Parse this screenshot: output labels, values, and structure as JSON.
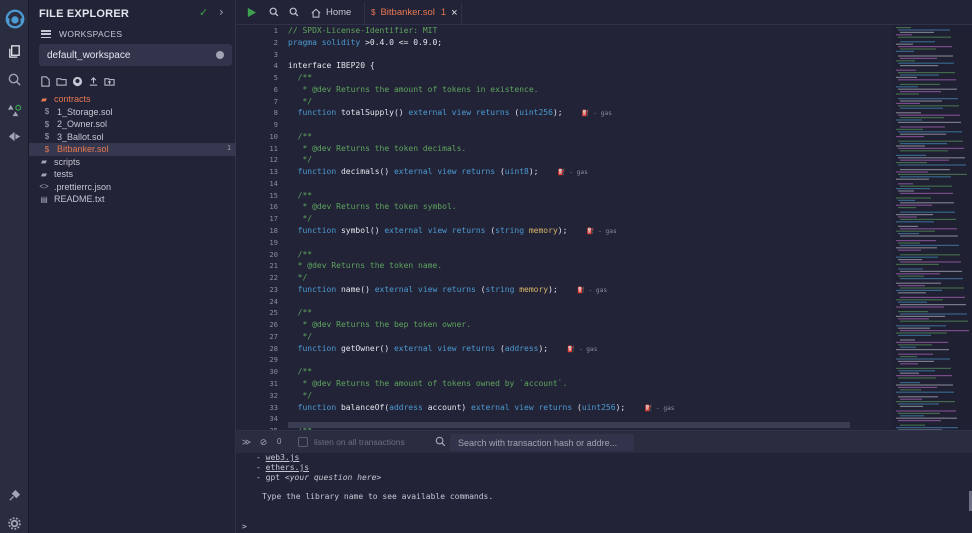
{
  "explorer": {
    "title": "FILE EXPLORER",
    "workspaces_label": "WORKSPACES",
    "workspace_selected": "default_workspace",
    "tree": [
      {
        "label": "contracts",
        "type": "folder",
        "level": 0,
        "state": "open"
      },
      {
        "label": "1_Storage.sol",
        "type": "sol",
        "level": 1,
        "state": ""
      },
      {
        "label": "2_Owner.sol",
        "type": "sol",
        "level": 1,
        "state": ""
      },
      {
        "label": "3_Ballot.sol",
        "type": "sol",
        "level": 1,
        "state": ""
      },
      {
        "label": "Bitbanker.sol",
        "type": "sol",
        "level": 1,
        "state": "selected"
      },
      {
        "label": "scripts",
        "type": "folder",
        "level": 0,
        "state": ""
      },
      {
        "label": "tests",
        "type": "folder",
        "level": 0,
        "state": ""
      },
      {
        "label": ".prettierrc.json",
        "type": "json",
        "level": 0,
        "state": ""
      },
      {
        "label": "README.txt",
        "type": "txt",
        "level": 0,
        "state": ""
      }
    ],
    "selected_badge": "1"
  },
  "tabs": {
    "home_label": "Home",
    "file_label": "Bitbanker.sol",
    "file_warning": "1",
    "close_glyph": "×"
  },
  "editor": {
    "line_numbers": [
      "1",
      "2",
      "3",
      "4",
      "5",
      "6",
      "7",
      "8",
      "9",
      "10",
      "11",
      "12",
      "13",
      "14",
      "15",
      "16",
      "17",
      "18",
      "19",
      "20",
      "21",
      "22",
      "23",
      "24",
      "25",
      "26",
      "27",
      "28",
      "29",
      "30",
      "31",
      "32",
      "33",
      "34",
      "35"
    ],
    "gas_label": "- gas",
    "lines": [
      [
        [
          "c-com",
          "// SPDX-License-Identifier: MIT"
        ]
      ],
      [
        [
          "c-kw",
          "pragma solidity "
        ],
        [
          "c-hl",
          ">0.4.0 <= 0.9.0;"
        ]
      ],
      [],
      [
        [
          "c-hl",
          "interface IBEP20 {"
        ]
      ],
      [
        [
          "c-com",
          "  /**"
        ]
      ],
      [
        [
          "c-com",
          "   * @dev Returns the amount of tokens in existence."
        ]
      ],
      [
        [
          "c-com",
          "   */"
        ]
      ],
      [
        [
          "c-kw",
          "  function "
        ],
        [
          "c-hl",
          "totalSupply() "
        ],
        [
          "c-kw",
          "external view returns "
        ],
        [
          "c-hl",
          "("
        ],
        [
          "c-ty",
          "uint256"
        ],
        [
          "c-hl",
          ");    "
        ],
        [
          "c-gas",
          "GAS"
        ]
      ],
      [],
      [
        [
          "c-com",
          "  /**"
        ]
      ],
      [
        [
          "c-com",
          "   * @dev Returns the token decimals."
        ]
      ],
      [
        [
          "c-com",
          "   */"
        ]
      ],
      [
        [
          "c-kw",
          "  function "
        ],
        [
          "c-hl",
          "decimals() "
        ],
        [
          "c-kw",
          "external view returns "
        ],
        [
          "c-hl",
          "("
        ],
        [
          "c-ty",
          "uint8"
        ],
        [
          "c-hl",
          ");    "
        ],
        [
          "c-gas",
          "GAS"
        ]
      ],
      [],
      [
        [
          "c-com",
          "  /**"
        ]
      ],
      [
        [
          "c-com",
          "   * @dev Returns the token symbol."
        ]
      ],
      [
        [
          "c-com",
          "   */"
        ]
      ],
      [
        [
          "c-kw",
          "  function "
        ],
        [
          "c-hl",
          "symbol() "
        ],
        [
          "c-kw",
          "external view returns "
        ],
        [
          "c-hl",
          "("
        ],
        [
          "c-ty",
          "string "
        ],
        [
          "c-mem",
          "memory"
        ],
        [
          "c-hl",
          ");    "
        ],
        [
          "c-gas",
          "GAS"
        ]
      ],
      [],
      [
        [
          "c-com",
          "  /**"
        ]
      ],
      [
        [
          "c-com",
          "  * @dev Returns the token name."
        ]
      ],
      [
        [
          "c-com",
          "  */"
        ]
      ],
      [
        [
          "c-kw",
          "  function "
        ],
        [
          "c-hl",
          "name() "
        ],
        [
          "c-kw",
          "external view returns "
        ],
        [
          "c-hl",
          "("
        ],
        [
          "c-ty",
          "string "
        ],
        [
          "c-mem",
          "memory"
        ],
        [
          "c-hl",
          ");    "
        ],
        [
          "c-gas",
          "GAS"
        ]
      ],
      [],
      [
        [
          "c-com",
          "  /**"
        ]
      ],
      [
        [
          "c-com",
          "   * @dev Returns the bep token owner."
        ]
      ],
      [
        [
          "c-com",
          "   */"
        ]
      ],
      [
        [
          "c-kw",
          "  function "
        ],
        [
          "c-hl",
          "getOwner() "
        ],
        [
          "c-kw",
          "external view returns "
        ],
        [
          "c-hl",
          "("
        ],
        [
          "c-ty",
          "address"
        ],
        [
          "c-hl",
          ");    "
        ],
        [
          "c-gas",
          "GAS"
        ]
      ],
      [],
      [
        [
          "c-com",
          "  /**"
        ]
      ],
      [
        [
          "c-com",
          "   * @dev Returns the amount of tokens owned by `account`."
        ]
      ],
      [
        [
          "c-com",
          "   */"
        ]
      ],
      [
        [
          "c-kw",
          "  function "
        ],
        [
          "c-hl",
          "balanceOf("
        ],
        [
          "c-ty",
          "address "
        ],
        [
          "c-hl",
          "account) "
        ],
        [
          "c-kw",
          "external view returns "
        ],
        [
          "c-hl",
          "("
        ],
        [
          "c-ty",
          "uint256"
        ],
        [
          "c-hl",
          ");    "
        ],
        [
          "c-gas",
          "GAS"
        ]
      ],
      [],
      [
        [
          "c-com",
          "  /**"
        ]
      ]
    ]
  },
  "terminal": {
    "count": "0",
    "listen_label": "listen on all transactions",
    "search_placeholder": "Search with transaction hash or addre...",
    "line1_link": "web3.js",
    "line2_link": "ethers.js",
    "line3_prefix": "gpt ",
    "line3_hint": "<your question here>",
    "help": "Type the library name to see available commands.",
    "bullet": "-",
    "prompt": ">"
  },
  "colors": {
    "background": "#222336",
    "accent": "#e77852",
    "run": "#3fa14f"
  }
}
